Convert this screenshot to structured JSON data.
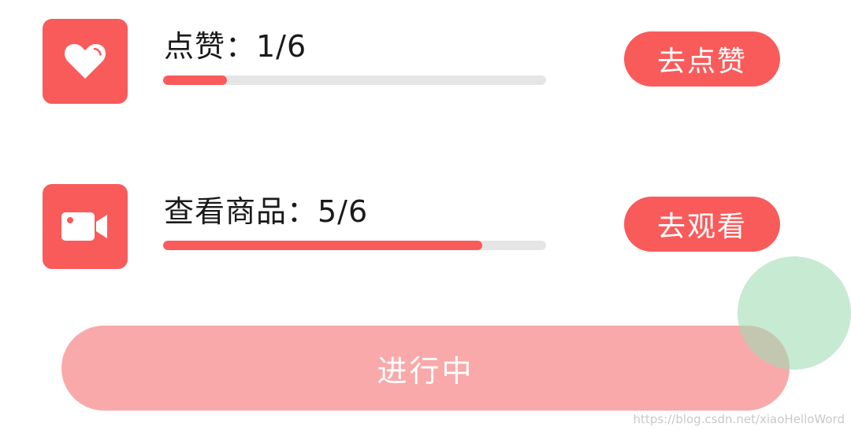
{
  "tasks": [
    {
      "icon": "heart-icon",
      "title": "点赞：1/6",
      "progress": 0.166,
      "action_label": "去点赞"
    },
    {
      "icon": "video-camera-icon",
      "title": "查看商品：5/6",
      "progress": 0.833,
      "action_label": "去观看"
    }
  ],
  "status_button": {
    "label": "进行中"
  },
  "colors": {
    "accent": "#f95b5b",
    "status_button_bg": "#f9a9a9",
    "track": "#e5e5e5",
    "fab_bubble": "#a0dcb4"
  },
  "watermark": "https://blog.csdn.net/xiaoHelloWord"
}
